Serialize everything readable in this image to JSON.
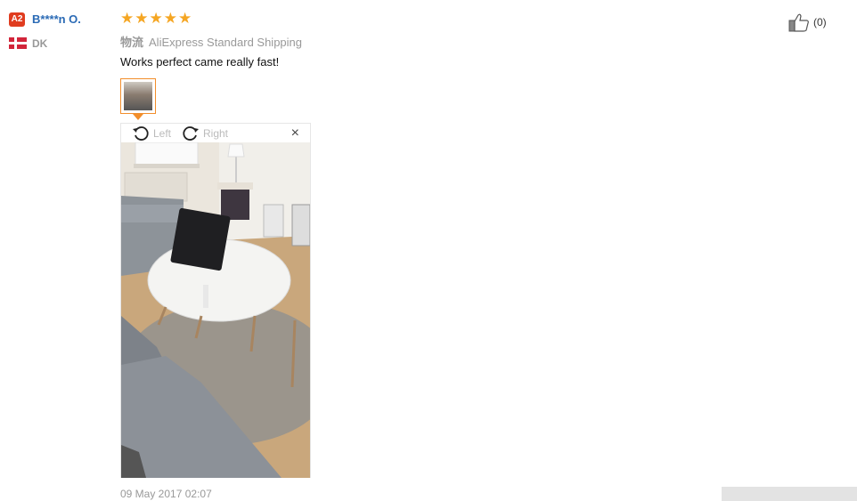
{
  "reviewer": {
    "level": "A2",
    "name": "B****n O.",
    "country": "DK"
  },
  "review": {
    "rating": 5,
    "stars": [
      "★",
      "★",
      "★",
      "★",
      "★"
    ],
    "shipping_label": "物流",
    "shipping_method": "AliExpress Standard Shipping",
    "text": "Works perfect came really fast!",
    "date": "09 May 2017 02:07"
  },
  "viewer": {
    "rotate_left_label": "Left",
    "rotate_right_label": "Right",
    "close_glyph": "×"
  },
  "helpful": {
    "count": "(0)"
  },
  "colors": {
    "star": "#f5a623",
    "accent": "#f28e2b",
    "name": "#2a6ab5",
    "badge": "#e03c1f"
  }
}
